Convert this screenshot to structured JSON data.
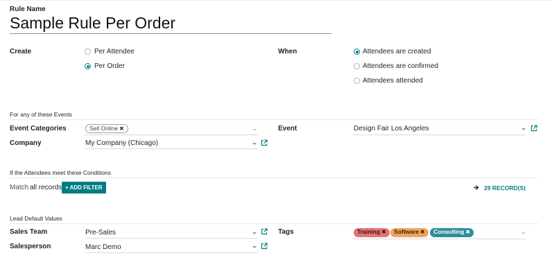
{
  "rule": {
    "name_label": "Rule Name",
    "name_value": "Sample Rule Per Order"
  },
  "create": {
    "label": "Create",
    "options": [
      {
        "label": "Per Attendee",
        "checked": false
      },
      {
        "label": "Per Order",
        "checked": true
      }
    ]
  },
  "when": {
    "label": "When",
    "options": [
      {
        "label": "Attendees are created",
        "checked": true
      },
      {
        "label": "Attendees are confirmed",
        "checked": false
      },
      {
        "label": "Attendees attended",
        "checked": false
      }
    ]
  },
  "events_section": {
    "title": "For any of these Events",
    "event_categories_label": "Event Categories",
    "event_categories_tag": "Sell Online",
    "company_label": "Company",
    "company_value": "My Company (Chicago)",
    "event_label": "Event",
    "event_value": "Design Fair Los Angeles"
  },
  "conditions_section": {
    "title": "If the Attendees meet these Conditions",
    "match_prefix": "Match",
    "match_value": "all records",
    "add_filter_label": "ADD FILTER",
    "records_label": "29 RECORD(S)"
  },
  "lead_section": {
    "title": "Lead Default Values",
    "sales_team_label": "Sales Team",
    "sales_team_value": "Pre-Sales",
    "salesperson_label": "Salesperson",
    "salesperson_value": "Marc Demo",
    "tags_label": "Tags",
    "tags": [
      {
        "label": "Training",
        "color": "#e57373"
      },
      {
        "label": "Software",
        "color": "#f0a35e"
      },
      {
        "label": "Consulting",
        "color": "#2e8d99"
      }
    ]
  },
  "colors": {
    "accent": "#017e84",
    "tag_training": "#e57373",
    "tag_software": "#f0a35e",
    "tag_consulting": "#2e8d99"
  },
  "icons": {
    "external_link": "external-link-icon",
    "remove_tag": "close-icon",
    "dropdown": "caret-down-icon",
    "arrow": "arrow-right-icon",
    "plus": "plus-icon"
  }
}
